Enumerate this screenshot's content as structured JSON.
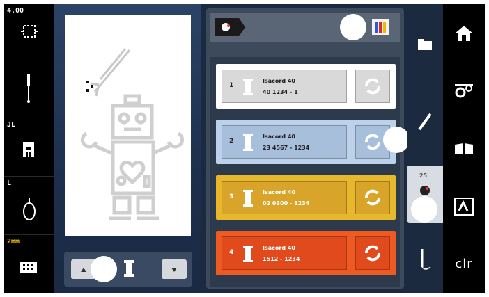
{
  "left_panel": {
    "speed_label": "4.00",
    "stitch_label": "JL",
    "foot_label": "L",
    "stitchlen_label": "2mm"
  },
  "color_panel": {
    "rows": [
      {
        "num": "1",
        "name": "Isacord 40",
        "code": "40 1234 - 1",
        "plate_color": "#d9d9d9",
        "bg_color": "#ffffff",
        "btn_color": "#d9d9d9",
        "light": false
      },
      {
        "num": "2",
        "name": "Isacord 40",
        "code": "23 4567 - 1234",
        "plate_color": "#a8bfdc",
        "bg_color": "#bcd2ea",
        "btn_color": "#a8bfdc",
        "light": false
      },
      {
        "num": "3",
        "name": "Isacord 40",
        "code": "02 0300 - 1234",
        "plate_color": "#d9a42a",
        "bg_color": "#e8b82c",
        "btn_color": "#d9a42a",
        "light": true
      },
      {
        "num": "4",
        "name": "Isacord 40",
        "code": "1512 - 1234",
        "plate_color": "#e04a1d",
        "bg_color": "#ee5a22",
        "btn_color": "#e04a1d",
        "light": true
      }
    ]
  },
  "side_col": {
    "badge": "25"
  },
  "right_panel": {
    "clr_label": "clr"
  },
  "colors": {
    "background": "#1b2a40",
    "panel_black": "#000000",
    "accent_yellow": "#f5c400"
  }
}
